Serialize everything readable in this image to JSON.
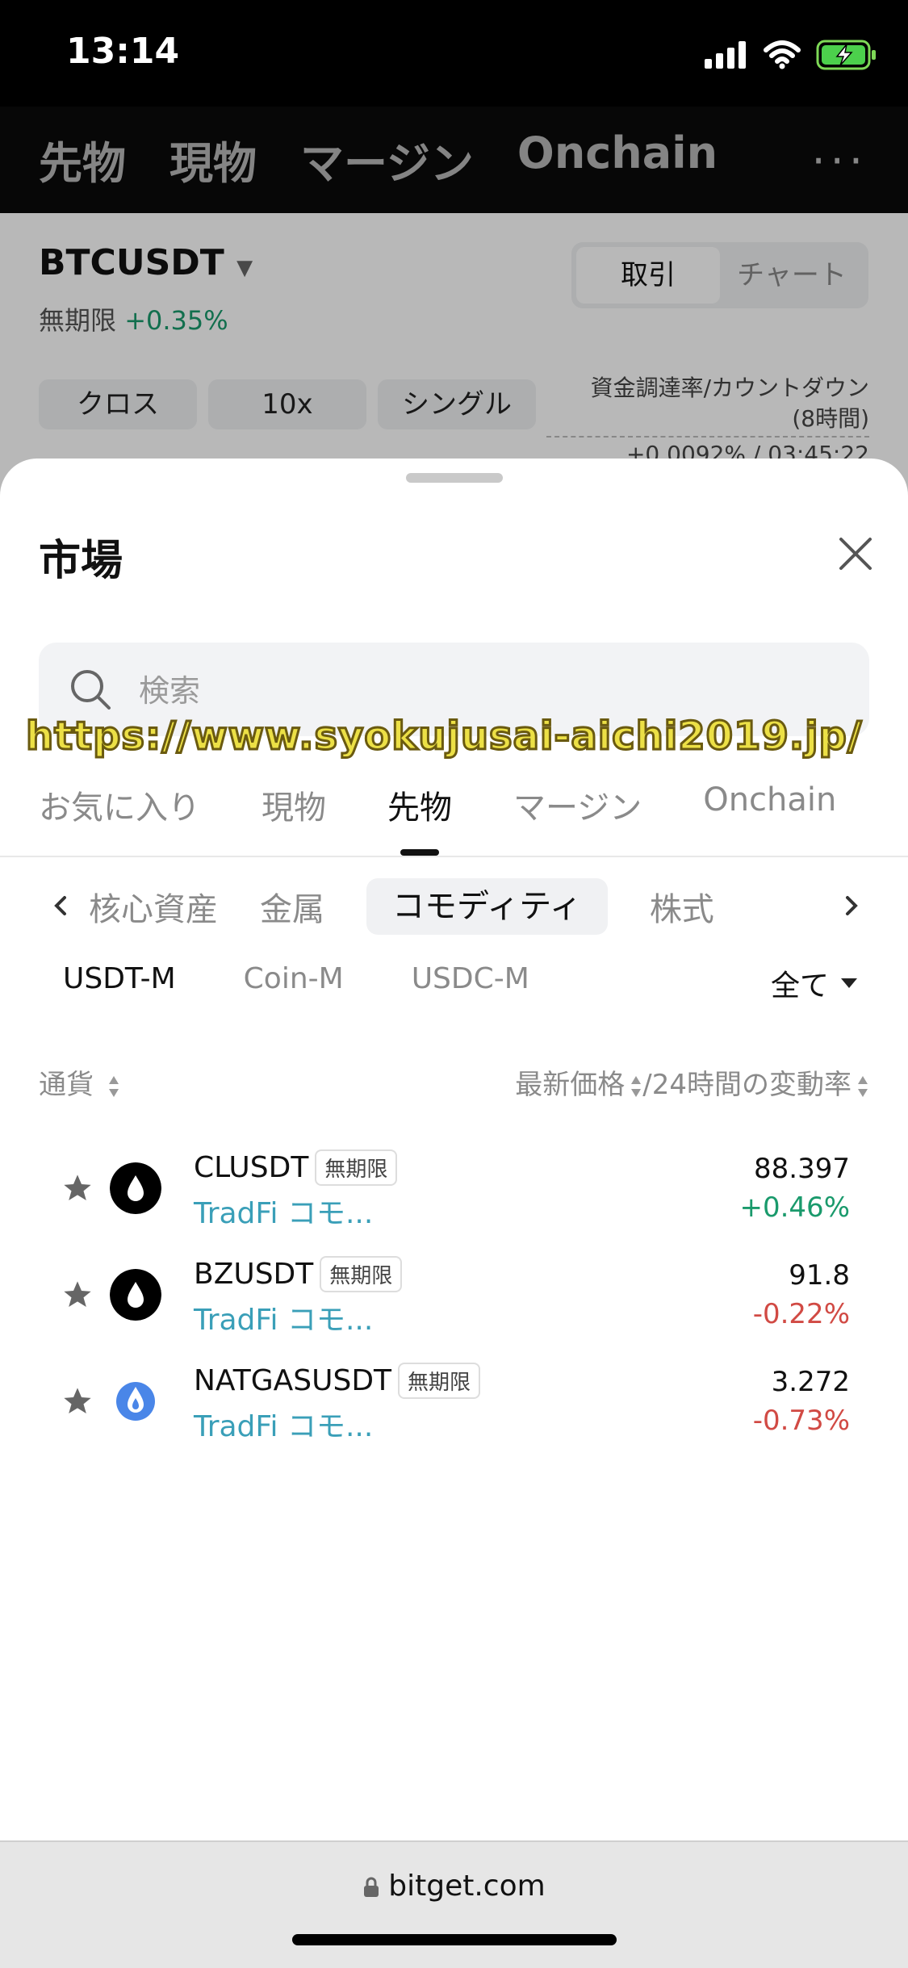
{
  "status_bar": {
    "time": "13:14"
  },
  "background": {
    "nav_tabs": [
      "先物",
      "現物",
      "マージン",
      "Onchain"
    ],
    "pair": "BTCUSDT",
    "pair_type": "無期限",
    "pair_change": "+0.35%",
    "toggle": [
      "取引",
      "チャート"
    ],
    "chips": [
      "クロス",
      "10x",
      "シングル"
    ],
    "funding_label_line1": "資金調達率/カウントダウン",
    "funding_label_line2": "(8時間)",
    "funding_value": "+0.0092% / 03:45:22",
    "more": "···"
  },
  "sheet": {
    "title": "市場",
    "search_placeholder": "検索",
    "watermark": "https://www.syokujusai-aichi2019.jp/",
    "tabs": [
      "お気に入り",
      "現物",
      "先物",
      "マージン",
      "Onchain"
    ],
    "active_tab": 2,
    "categories": [
      "核心資産",
      "金属",
      "コモディティ",
      "株式"
    ],
    "active_category": 2,
    "subtabs": [
      "USDT-M",
      "Coin-M",
      "USDC-M"
    ],
    "filter_label": "全て",
    "col_currency": "通貨",
    "col_price": "最新価格",
    "col_change": "/24時間の変動率",
    "rows": [
      {
        "symbol": "CLUSDT",
        "badge": "無期限",
        "category": "TradFi コモ...",
        "price": "88.397",
        "change": "+0.46%"
      },
      {
        "symbol": "BZUSDT",
        "badge": "無期限",
        "category": "TradFi コモ...",
        "price": "91.8",
        "change": "-0.22%"
      },
      {
        "symbol": "NATGASUSDT",
        "badge": "無期限",
        "category": "TradFi コモ...",
        "price": "3.272",
        "change": "-0.73%"
      }
    ]
  },
  "browser": {
    "url": "bitget.com"
  },
  "colors": {
    "up": "#1a9a6c",
    "down": "#d14a44",
    "category_link": "#3a9fb8"
  }
}
